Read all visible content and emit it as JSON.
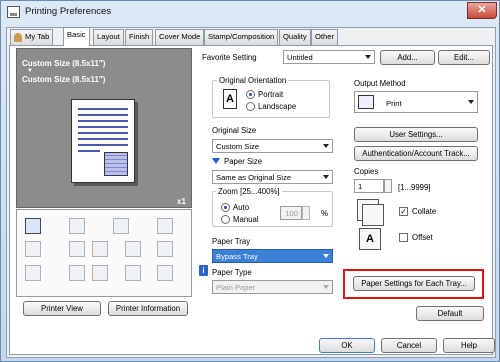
{
  "window": {
    "title": "Printing Preferences",
    "close_glyph": "✕"
  },
  "tabs": [
    {
      "label": "My Tab"
    },
    {
      "label": "Basic"
    },
    {
      "label": "Layout"
    },
    {
      "label": "Finish"
    },
    {
      "label": "Cover Mode"
    },
    {
      "label": "Stamp/Composition"
    },
    {
      "label": "Quality"
    },
    {
      "label": "Other"
    }
  ],
  "favorite": {
    "label": "Favorite Setting",
    "value": "Untitled",
    "add_label": "Add...",
    "edit_label": "Edit..."
  },
  "preview": {
    "line1": "Custom Size (8.5x11\")",
    "arrow": "▼",
    "line2": "Custom Size (8.5x11\")",
    "copies_badge": "x1"
  },
  "preview_buttons": {
    "printer_view": "Printer View",
    "printer_info": "Printer Information"
  },
  "orientation": {
    "label": "Original Orientation",
    "portrait": "Portrait",
    "landscape": "Landscape",
    "selected": "Portrait",
    "icon_letter": "A"
  },
  "original_size": {
    "label": "Original Size",
    "value": "Custom Size"
  },
  "paper_size": {
    "label": "Paper Size",
    "value": "Same as Original Size"
  },
  "zoom": {
    "label": "Zoom [25...400%]",
    "auto": "Auto",
    "manual": "Manual",
    "value": "100",
    "unit": "%"
  },
  "paper_tray": {
    "label": "Paper Tray",
    "value": "Bypass Tray"
  },
  "paper_type": {
    "label": "Paper Type",
    "value": "Plain Paper",
    "info_glyph": "i"
  },
  "output": {
    "label": "Output Method",
    "value": "Print",
    "user_settings": "User Settings...",
    "auth": "Authentication/Account Track..."
  },
  "copies": {
    "label": "Copies",
    "value": "1",
    "range": "[1...9999]",
    "collate": "Collate",
    "offset": "Offset",
    "collate_checked": true,
    "offset_checked": false,
    "check_glyph": "✓"
  },
  "paper_settings_tray": "Paper Settings for Each Tray...",
  "default_label": "Default",
  "footer": {
    "ok": "OK",
    "cancel": "Cancel",
    "help": "Help"
  },
  "colors": {
    "selected_blue": "#3c7fd6",
    "highlight_red": "#e0101a",
    "preview_gray": "#8c8c8c"
  }
}
